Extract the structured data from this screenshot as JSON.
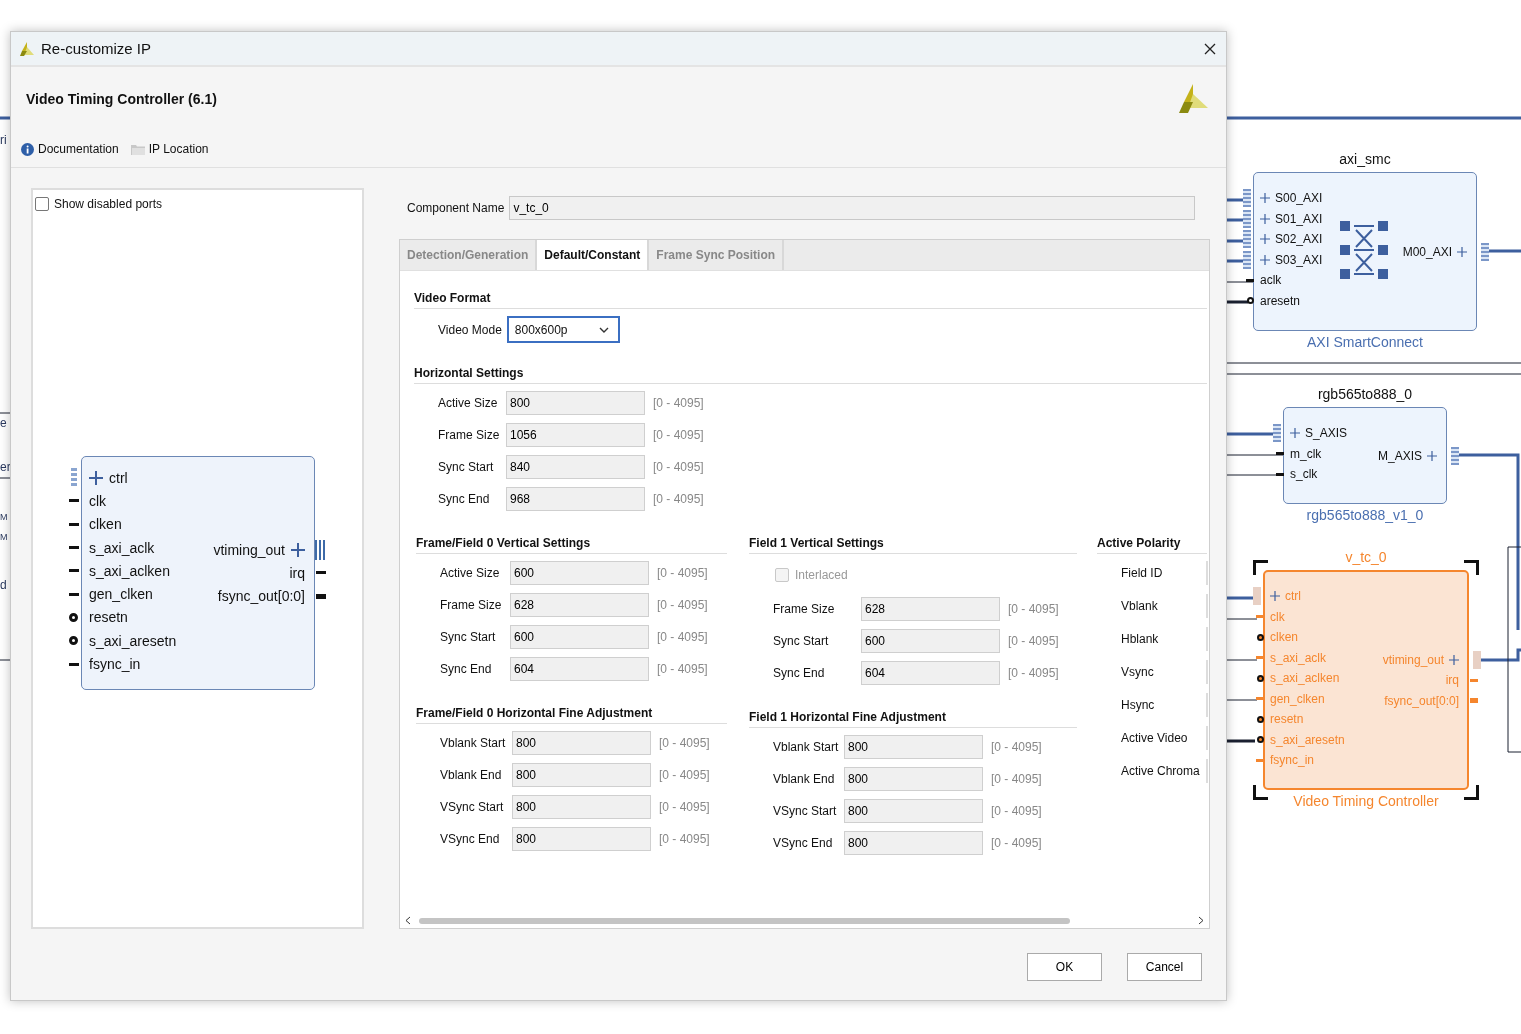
{
  "window": {
    "title": "Re-customize IP"
  },
  "header": {
    "title": "Video Timing Controller (6.1)",
    "links": [
      {
        "label": "Documentation",
        "kind": "info"
      },
      {
        "label": "IP Location",
        "kind": "folder"
      }
    ]
  },
  "symbol": {
    "show_disabled_ports": {
      "label": "Show disabled ports",
      "checked": false
    },
    "left_ports": [
      {
        "name": "ctrl",
        "kind": "bus"
      },
      {
        "name": "clk",
        "kind": "wire"
      },
      {
        "name": "clken",
        "kind": "wire"
      },
      {
        "name": "s_axi_aclk",
        "kind": "wire"
      },
      {
        "name": "s_axi_aclken",
        "kind": "wire"
      },
      {
        "name": "gen_clken",
        "kind": "wire"
      },
      {
        "name": "resetn",
        "kind": "neg"
      },
      {
        "name": "s_axi_aresetn",
        "kind": "neg"
      },
      {
        "name": "fsync_in",
        "kind": "wire"
      }
    ],
    "right_ports": [
      {
        "name": "vtiming_out",
        "kind": "bus"
      },
      {
        "name": "irq",
        "kind": "wire"
      },
      {
        "name": "fsync_out[0:0]",
        "kind": "vector"
      }
    ]
  },
  "component_name": {
    "label": "Component Name",
    "value": "v_tc_0"
  },
  "tabs": [
    {
      "label": "Detection/Generation",
      "selected": false
    },
    {
      "label": "Default/Constant",
      "selected": true
    },
    {
      "label": "Frame Sync Position",
      "selected": false
    }
  ],
  "video_format": {
    "title": "Video Format",
    "label": "Video Mode",
    "value": "800x600p"
  },
  "horizontal": {
    "title": "Horizontal Settings",
    "fields": [
      {
        "label": "Active Size",
        "value": "800",
        "range": "[0 - 4095]"
      },
      {
        "label": "Frame Size",
        "value": "1056",
        "range": "[0 - 4095]"
      },
      {
        "label": "Sync Start",
        "value": "840",
        "range": "[0 - 4095]"
      },
      {
        "label": "Sync End",
        "value": "968",
        "range": "[0 - 4095]"
      }
    ]
  },
  "vertical0": {
    "title": "Frame/Field 0 Vertical Settings",
    "fields": [
      {
        "label": "Active Size",
        "value": "600",
        "range": "[0 - 4095]"
      },
      {
        "label": "Frame Size",
        "value": "628",
        "range": "[0 - 4095]"
      },
      {
        "label": "Sync Start",
        "value": "600",
        "range": "[0 - 4095]"
      },
      {
        "label": "Sync End",
        "value": "604",
        "range": "[0 - 4095]"
      }
    ]
  },
  "fine0": {
    "title": "Frame/Field 0 Horizontal Fine Adjustment",
    "fields": [
      {
        "label": "Vblank Start",
        "value": "800",
        "range": "[0 - 4095]"
      },
      {
        "label": "Vblank End",
        "value": "800",
        "range": "[0 - 4095]"
      },
      {
        "label": "VSync Start",
        "value": "800",
        "range": "[0 - 4095]"
      },
      {
        "label": "VSync End",
        "value": "800",
        "range": "[0 - 4095]"
      }
    ]
  },
  "vertical1": {
    "title": "Field 1 Vertical Settings",
    "interlaced": {
      "label": "Interlaced",
      "checked": false,
      "disabled": true
    },
    "fields": [
      {
        "label": "Frame Size",
        "value": "628",
        "range": "[0 - 4095]"
      },
      {
        "label": "Sync Start",
        "value": "600",
        "range": "[0 - 4095]"
      },
      {
        "label": "Sync End",
        "value": "604",
        "range": "[0 - 4095]"
      }
    ]
  },
  "fine1": {
    "title": "Field 1 Horizontal Fine Adjustment",
    "fields": [
      {
        "label": "Vblank Start",
        "value": "800",
        "range": "[0 - 4095]"
      },
      {
        "label": "Vblank End",
        "value": "800",
        "range": "[0 - 4095]"
      },
      {
        "label": "VSync Start",
        "value": "800",
        "range": "[0 - 4095]"
      },
      {
        "label": "VSync End",
        "value": "800",
        "range": "[0 - 4095]"
      }
    ]
  },
  "polarity": {
    "title": "Active Polarity",
    "items": [
      "Field ID",
      "Vblank",
      "Hblank",
      "Vsync",
      "Hsync",
      "Active Video",
      "Active Chroma"
    ]
  },
  "buttons": [
    {
      "label": "OK"
    },
    {
      "label": "Cancel"
    }
  ],
  "canvas": {
    "edge_fragments": [
      "ri",
      "e",
      "er",
      "M",
      "M",
      "d"
    ],
    "blocks": [
      {
        "name": "axi_smc",
        "type": "AXI SmartConnect",
        "selected": false,
        "left_ports": [
          {
            "name": "S00_AXI",
            "kind": "bus"
          },
          {
            "name": "S01_AXI",
            "kind": "bus"
          },
          {
            "name": "S02_AXI",
            "kind": "bus"
          },
          {
            "name": "S03_AXI",
            "kind": "bus"
          },
          {
            "name": "aclk",
            "kind": "wire"
          },
          {
            "name": "aresetn",
            "kind": "neg"
          }
        ],
        "right_ports": [
          {
            "name": "M00_AXI",
            "kind": "bus"
          }
        ]
      },
      {
        "name": "rgb565to888_0",
        "type": "rgb565to888_v1_0",
        "selected": false,
        "left_ports": [
          {
            "name": "S_AXIS",
            "kind": "bus"
          },
          {
            "name": "m_clk",
            "kind": "wire"
          },
          {
            "name": "s_clk",
            "kind": "wire"
          }
        ],
        "right_ports": [
          {
            "name": "M_AXIS",
            "kind": "bus"
          }
        ]
      },
      {
        "name": "v_tc_0",
        "type": "Video Timing Controller",
        "selected": true,
        "left_ports": [
          {
            "name": "ctrl",
            "kind": "bus"
          },
          {
            "name": "clk",
            "kind": "wire"
          },
          {
            "name": "clken",
            "kind": "neg"
          },
          {
            "name": "s_axi_aclk",
            "kind": "wire"
          },
          {
            "name": "s_axi_aclken",
            "kind": "neg"
          },
          {
            "name": "gen_clken",
            "kind": "wire"
          },
          {
            "name": "resetn",
            "kind": "neg"
          },
          {
            "name": "s_axi_aresetn",
            "kind": "neg"
          },
          {
            "name": "fsync_in",
            "kind": "wire"
          }
        ],
        "right_ports": [
          {
            "name": "vtiming_out",
            "kind": "bus"
          },
          {
            "name": "irq",
            "kind": "wire"
          },
          {
            "name": "fsync_out[0:0]",
            "kind": "vector"
          }
        ]
      }
    ]
  }
}
